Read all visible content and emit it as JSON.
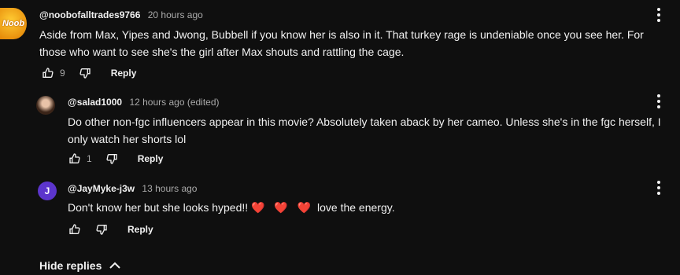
{
  "comments": [
    {
      "author": "@noobofalltrades9766",
      "time": "20 hours ago",
      "avatar_text": "Noob",
      "text": "Aside from Max, Yipes and Jwong, Bubbell if you know her is also in it. That turkey rage is undeniable once you see her. For those who want to see she's the girl after Max shouts and rattling the cage.",
      "likes": "9",
      "reply_label": "Reply"
    },
    {
      "author": "@salad1000",
      "time": "12 hours ago (edited)",
      "text": "Do other non-fgc influencers appear in this movie? Absolutely taken aback by her cameo. Unless she's in the fgc herself, I only watch her shorts lol",
      "likes": "1",
      "reply_label": "Reply"
    },
    {
      "author": "@JayMyke-j3w",
      "time": "13 hours ago",
      "avatar_letter": "J",
      "text_before": "Don't know her but she looks hyped!!",
      "hearts": "❤️ ❤️ ❤️",
      "text_after": "love the energy.",
      "reply_label": "Reply"
    }
  ],
  "hide_replies_label": "Hide replies",
  "colors": {
    "background": "#0f0f0f",
    "text": "#f1f1f1",
    "muted": "#aaaaaa",
    "avatar_j": "#5c35cc",
    "avatar_noob": "#f0a020"
  }
}
